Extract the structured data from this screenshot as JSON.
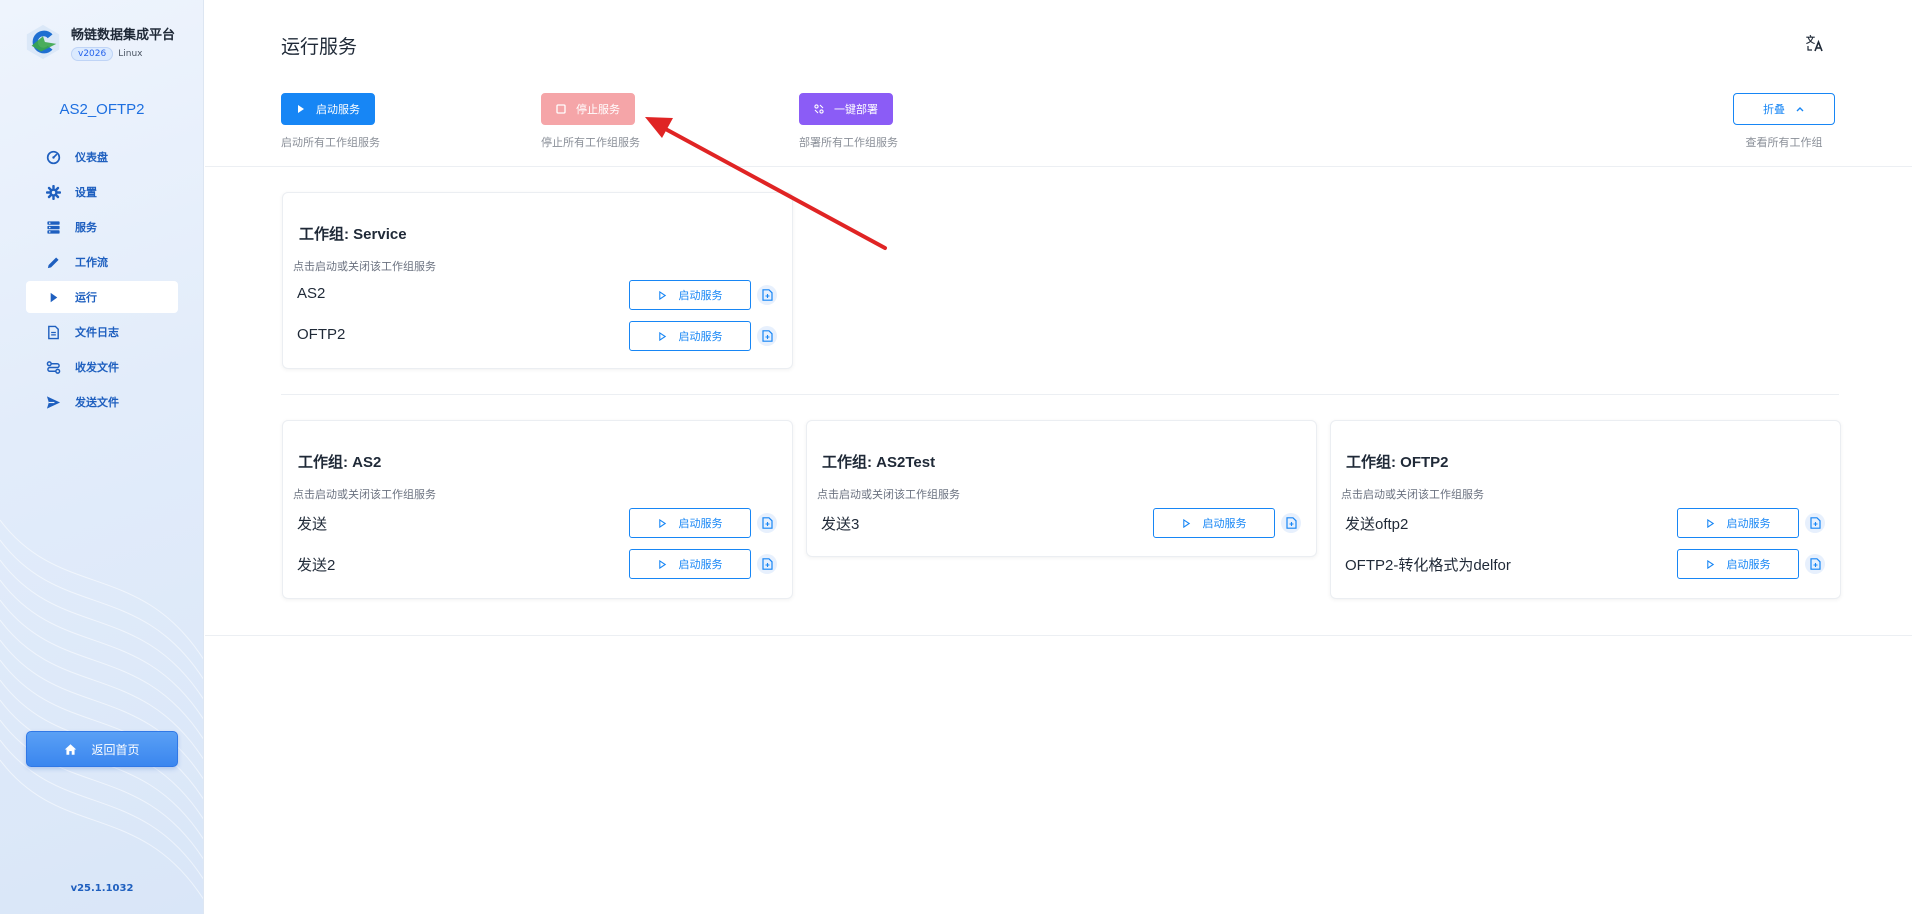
{
  "sidebar": {
    "brand_name": "畅链数据集成平台",
    "version_badge": "v2026",
    "os": "Linux",
    "project": "AS2_OFTP2",
    "items": [
      {
        "label": "仪表盘",
        "icon": "dashboard-icon"
      },
      {
        "label": "设置",
        "icon": "gear-icon"
      },
      {
        "label": "服务",
        "icon": "server-icon"
      },
      {
        "label": "工作流",
        "icon": "pencil-icon"
      },
      {
        "label": "运行",
        "icon": "play-icon"
      },
      {
        "label": "文件日志",
        "icon": "file-log-icon"
      },
      {
        "label": "收发文件",
        "icon": "transfer-icon"
      },
      {
        "label": "发送文件",
        "icon": "send-icon"
      }
    ],
    "active_index": 4,
    "home_label": "返回首页",
    "build_version": "v25.1.1032"
  },
  "header": {
    "title": "运行服务"
  },
  "toolbar": {
    "start_label": "启动服务",
    "start_hint": "启动所有工作组服务",
    "stop_label": "停止服务",
    "stop_hint": "停止所有工作组服务",
    "deploy_label": "一键部署",
    "deploy_hint": "部署所有工作组服务",
    "collapse_label": "折叠",
    "collapse_hint": "查看所有工作组"
  },
  "groups": [
    {
      "title": "工作组: Service",
      "subtitle": "点击启动或关闭该工作组服务",
      "rows": [
        {
          "name": "AS2",
          "button": "启动服务"
        },
        {
          "name": "OFTP2",
          "button": "启动服务"
        }
      ]
    },
    {
      "title": "工作组: AS2",
      "subtitle": "点击启动或关闭该工作组服务",
      "rows": [
        {
          "name": "发送",
          "button": "启动服务"
        },
        {
          "name": "发送2",
          "button": "启动服务"
        }
      ]
    },
    {
      "title": "工作组: AS2Test",
      "subtitle": "点击启动或关闭该工作组服务",
      "rows": [
        {
          "name": "发送3",
          "button": "启动服务"
        }
      ]
    },
    {
      "title": "工作组: OFTP2",
      "subtitle": "点击启动或关闭该工作组服务",
      "rows": [
        {
          "name": "发送oftp2",
          "button": "启动服务"
        },
        {
          "name": "OFTP2-转化格式为delfor",
          "button": "启动服务"
        }
      ]
    }
  ],
  "colors": {
    "primary": "#1786f5",
    "stop": "#f5a5a8",
    "deploy": "#8b5cf6",
    "annotation_arrow": "#e02424"
  }
}
